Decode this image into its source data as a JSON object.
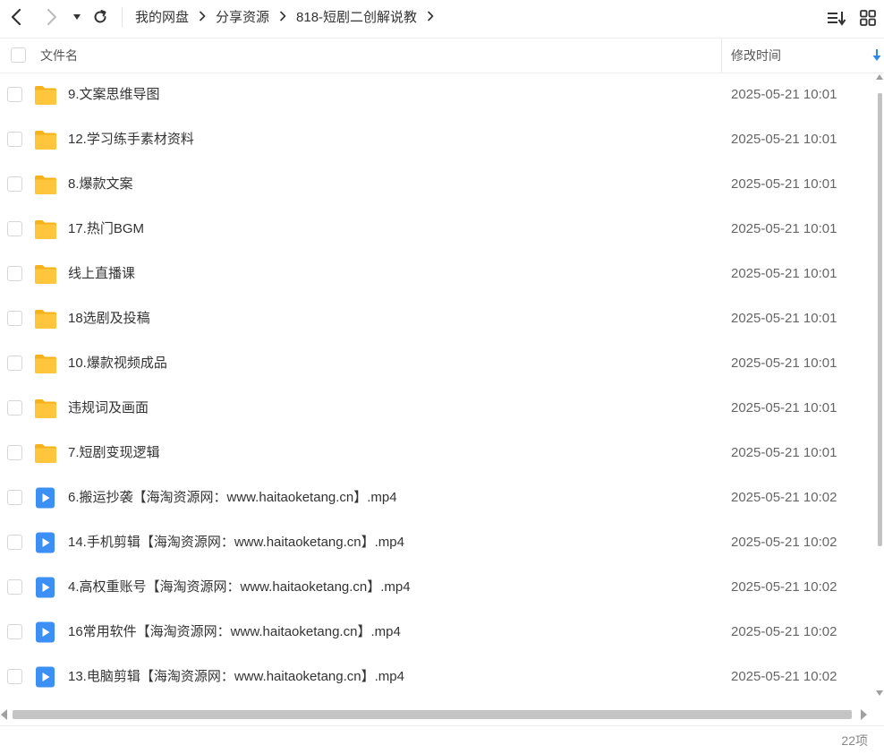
{
  "toolbar": {
    "back_icon": "chevron-left-icon",
    "forward_icon": "chevron-right-icon",
    "history_icon": "caret-down-icon",
    "refresh_icon": "refresh-icon",
    "sort_icon": "sort-list-icon",
    "grid_icon": "grid-view-icon"
  },
  "breadcrumb": [
    {
      "label": "我的网盘"
    },
    {
      "label": "分享资源"
    },
    {
      "label": "818-短剧二创解说教"
    }
  ],
  "header": {
    "name_label": "文件名",
    "time_label": "修改时间",
    "sort_icon": "sort-down-arrow-icon"
  },
  "files": [
    {
      "name": "9.文案思维导图",
      "time": "2025-05-21 10:01",
      "type": "folder"
    },
    {
      "name": "12.学习练手素材资料",
      "time": "2025-05-21 10:01",
      "type": "folder"
    },
    {
      "name": "8.爆款文案",
      "time": "2025-05-21 10:01",
      "type": "folder"
    },
    {
      "name": "17.热门BGM",
      "time": "2025-05-21 10:01",
      "type": "folder"
    },
    {
      "name": "线上直播课",
      "time": "2025-05-21 10:01",
      "type": "folder"
    },
    {
      "name": "18选剧及投稿",
      "time": "2025-05-21 10:01",
      "type": "folder"
    },
    {
      "name": "10.爆款视频成品",
      "time": "2025-05-21 10:01",
      "type": "folder"
    },
    {
      "name": "违规词及画面",
      "time": "2025-05-21 10:01",
      "type": "folder"
    },
    {
      "name": "7.短剧变现逻辑",
      "time": "2025-05-21 10:01",
      "type": "folder"
    },
    {
      "name": "6.搬运抄袭【海淘资源网：www.haitaoketang.cn】.mp4",
      "time": "2025-05-21 10:02",
      "type": "video"
    },
    {
      "name": "14.手机剪辑【海淘资源网：www.haitaoketang.cn】.mp4",
      "time": "2025-05-21 10:02",
      "type": "video"
    },
    {
      "name": "4.高权重账号【海淘资源网：www.haitaoketang.cn】.mp4",
      "time": "2025-05-21 10:02",
      "type": "video"
    },
    {
      "name": "16常用软件【海淘资源网：www.haitaoketang.cn】.mp4",
      "time": "2025-05-21 10:02",
      "type": "video"
    },
    {
      "name": "13.电脑剪辑【海淘资源网：www.haitaoketang.cn】.mp4",
      "time": "2025-05-21 10:02",
      "type": "video"
    }
  ],
  "footer": {
    "count": "22项"
  },
  "colors": {
    "folder": "#FFC53D",
    "video": "#3B8FF5",
    "accent": "#2F87F0"
  }
}
